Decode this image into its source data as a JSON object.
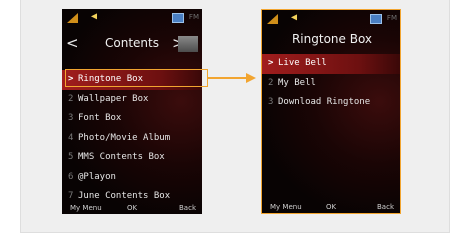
{
  "left_screen": {
    "title": "Contents",
    "prev_arrow": "<",
    "next_arrow": ">",
    "items": [
      {
        "num": ">",
        "label": "Ringtone Box"
      },
      {
        "num": "2",
        "label": "Wallpaper Box"
      },
      {
        "num": "3",
        "label": "Font Box"
      },
      {
        "num": "4",
        "label": "Photo/Movie Album"
      },
      {
        "num": "5",
        "label": "MMS Contents Box"
      },
      {
        "num": "6",
        "label": "@Playon"
      },
      {
        "num": "7",
        "label": "June Contents Box"
      }
    ],
    "softkeys": {
      "left": "My Menu",
      "center": "OK",
      "right": "Back"
    }
  },
  "right_screen": {
    "title": "Ringtone Box",
    "items": [
      {
        "num": ">",
        "label": "Live Bell"
      },
      {
        "num": "2",
        "label": "My Bell"
      },
      {
        "num": "3",
        "label": "Download Ringtone"
      }
    ],
    "softkeys": {
      "left": "My Menu",
      "center": "OK",
      "right": "Back"
    }
  },
  "status": {
    "speaker_icon": "speaker-icon",
    "signal_icon": "signal-icon",
    "battery_icon": "battery-icon"
  },
  "colors": {
    "highlight": "#f2a530",
    "selection": "#a11d1d",
    "screen_bg": "#0a0606"
  }
}
